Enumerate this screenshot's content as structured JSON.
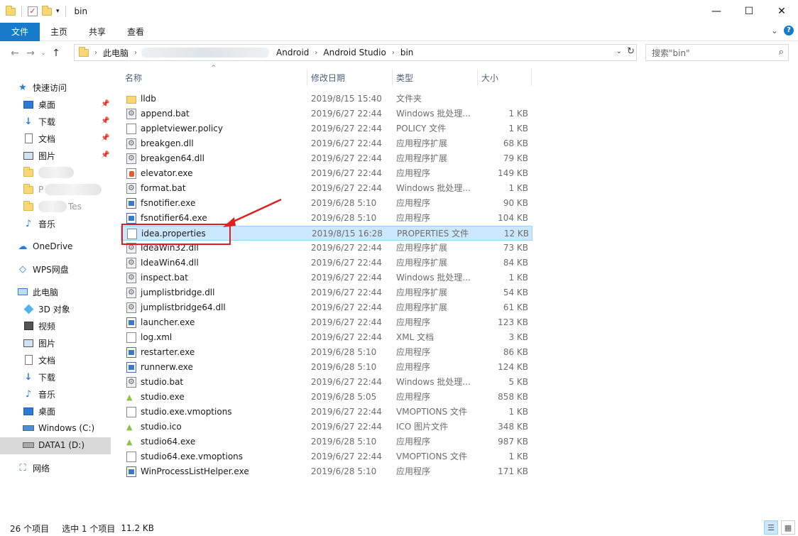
{
  "window": {
    "title": "bin",
    "controls": {
      "minimize": "—",
      "maximize": "☐",
      "close": "✕"
    }
  },
  "ribbon": {
    "tabs": [
      "文件",
      "主页",
      "共享",
      "查看"
    ],
    "collapse": "⌄",
    "help": "?"
  },
  "address": {
    "crumbs": [
      "此电脑",
      "Android",
      "Android Studio",
      "bin"
    ],
    "search_placeholder": "搜索\"bin\""
  },
  "nav": {
    "quick_access": "快速访问",
    "quick_items": [
      {
        "label": "桌面",
        "icon": "desktop-icon"
      },
      {
        "label": "下载",
        "icon": "download-icon"
      },
      {
        "label": "文档",
        "icon": "document-icon"
      },
      {
        "label": "图片",
        "icon": "picture-icon"
      }
    ],
    "partial_items": [
      "P",
      "Tes"
    ],
    "music": "音乐",
    "onedrive": "OneDrive",
    "wps": "WPS网盘",
    "this_pc": "此电脑",
    "pc_items": [
      {
        "label": "3D 对象",
        "icon": "3d-objects-icon"
      },
      {
        "label": "视频",
        "icon": "video-icon"
      },
      {
        "label": "图片",
        "icon": "picture-icon"
      },
      {
        "label": "文档",
        "icon": "document-icon"
      },
      {
        "label": "下载",
        "icon": "download-icon"
      },
      {
        "label": "音乐",
        "icon": "music-icon"
      },
      {
        "label": "桌面",
        "icon": "desktop-icon"
      },
      {
        "label": "Windows (C:)",
        "icon": "drive-icon"
      },
      {
        "label": "DATA1 (D:)",
        "icon": "drive-icon"
      }
    ],
    "network": "网络"
  },
  "columns": {
    "name": "名称",
    "date": "修改日期",
    "type": "类型",
    "size": "大小"
  },
  "files": [
    {
      "name": "lldb",
      "date": "2019/8/15 15:40",
      "type": "文件夹",
      "size": "",
      "icon": "folder"
    },
    {
      "name": "append.bat",
      "date": "2019/6/27 22:44",
      "type": "Windows 批处理...",
      "size": "1 KB",
      "icon": "gear"
    },
    {
      "name": "appletviewer.policy",
      "date": "2019/6/27 22:44",
      "type": "POLICY 文件",
      "size": "1 KB",
      "icon": "file"
    },
    {
      "name": "breakgen.dll",
      "date": "2019/6/27 22:44",
      "type": "应用程序扩展",
      "size": "68 KB",
      "icon": "gear"
    },
    {
      "name": "breakgen64.dll",
      "date": "2019/6/27 22:44",
      "type": "应用程序扩展",
      "size": "79 KB",
      "icon": "gear"
    },
    {
      "name": "elevator.exe",
      "date": "2019/6/27 22:44",
      "type": "应用程序",
      "size": "149 KB",
      "icon": "elev"
    },
    {
      "name": "format.bat",
      "date": "2019/6/27 22:44",
      "type": "Windows 批处理...",
      "size": "1 KB",
      "icon": "gear"
    },
    {
      "name": "fsnotifier.exe",
      "date": "2019/6/28 5:10",
      "type": "应用程序",
      "size": "90 KB",
      "icon": "exe"
    },
    {
      "name": "fsnotifier64.exe",
      "date": "2019/6/28 5:10",
      "type": "应用程序",
      "size": "104 KB",
      "icon": "exe"
    },
    {
      "name": "idea.properties",
      "date": "2019/8/15 16:28",
      "type": "PROPERTIES 文件",
      "size": "12 KB",
      "icon": "file",
      "selected": true
    },
    {
      "name": "IdeaWin32.dll",
      "date": "2019/6/27 22:44",
      "type": "应用程序扩展",
      "size": "73 KB",
      "icon": "gear"
    },
    {
      "name": "IdeaWin64.dll",
      "date": "2019/6/27 22:44",
      "type": "应用程序扩展",
      "size": "84 KB",
      "icon": "gear"
    },
    {
      "name": "inspect.bat",
      "date": "2019/6/27 22:44",
      "type": "Windows 批处理...",
      "size": "1 KB",
      "icon": "gear"
    },
    {
      "name": "jumplistbridge.dll",
      "date": "2019/6/27 22:44",
      "type": "应用程序扩展",
      "size": "54 KB",
      "icon": "gear"
    },
    {
      "name": "jumplistbridge64.dll",
      "date": "2019/6/27 22:44",
      "type": "应用程序扩展",
      "size": "61 KB",
      "icon": "gear"
    },
    {
      "name": "launcher.exe",
      "date": "2019/6/27 22:44",
      "type": "应用程序",
      "size": "123 KB",
      "icon": "exe"
    },
    {
      "name": "log.xml",
      "date": "2019/6/27 22:44",
      "type": "XML 文档",
      "size": "3 KB",
      "icon": "file"
    },
    {
      "name": "restarter.exe",
      "date": "2019/6/28 5:10",
      "type": "应用程序",
      "size": "86 KB",
      "icon": "exe"
    },
    {
      "name": "runnerw.exe",
      "date": "2019/6/28 5:10",
      "type": "应用程序",
      "size": "124 KB",
      "icon": "exe"
    },
    {
      "name": "studio.bat",
      "date": "2019/6/27 22:44",
      "type": "Windows 批处理...",
      "size": "5 KB",
      "icon": "gear"
    },
    {
      "name": "studio.exe",
      "date": "2019/6/28 5:05",
      "type": "应用程序",
      "size": "858 KB",
      "icon": "android"
    },
    {
      "name": "studio.exe.vmoptions",
      "date": "2019/6/27 22:44",
      "type": "VMOPTIONS 文件",
      "size": "1 KB",
      "icon": "file"
    },
    {
      "name": "studio.ico",
      "date": "2019/6/27 22:44",
      "type": "ICO 图片文件",
      "size": "348 KB",
      "icon": "android"
    },
    {
      "name": "studio64.exe",
      "date": "2019/6/28 5:10",
      "type": "应用程序",
      "size": "987 KB",
      "icon": "android"
    },
    {
      "name": "studio64.exe.vmoptions",
      "date": "2019/6/27 22:44",
      "type": "VMOPTIONS 文件",
      "size": "1 KB",
      "icon": "file"
    },
    {
      "name": "WinProcessListHelper.exe",
      "date": "2019/6/28 5:10",
      "type": "应用程序",
      "size": "171 KB",
      "icon": "exe"
    }
  ],
  "status": {
    "count": "26 个项目",
    "selection": "选中 1 个项目",
    "size": "11.2 KB"
  },
  "colors": {
    "accent": "#1979ca",
    "selection_bg": "#cce8ff",
    "annotation": "#e02020"
  }
}
